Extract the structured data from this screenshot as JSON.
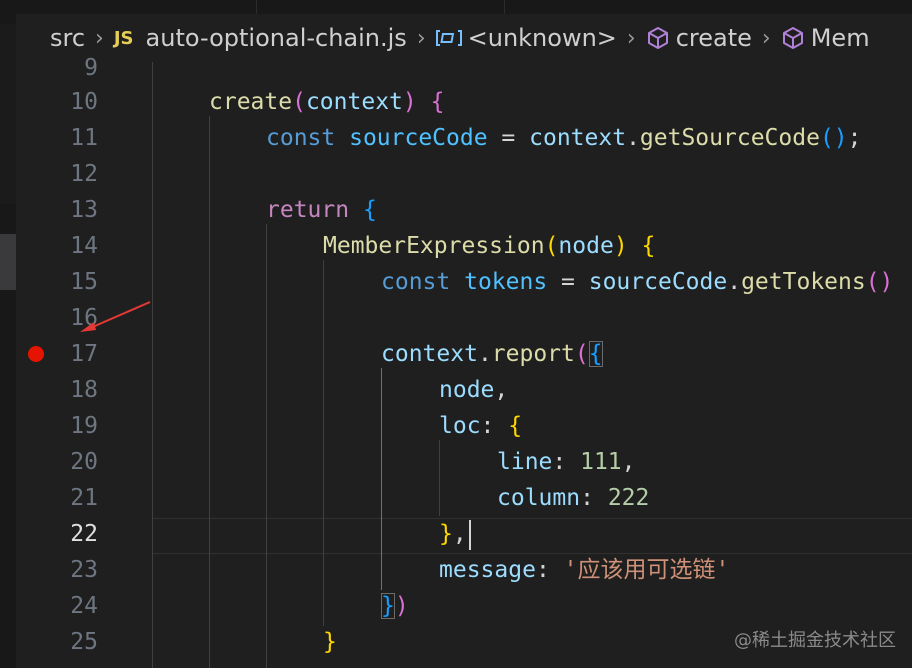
{
  "breadcrumb": {
    "folder": "src",
    "file_badge": "JS",
    "file": "auto-optional-chain.js",
    "scope1": "<unknown>",
    "scope2": "create",
    "scope3": "Mem"
  },
  "editor": {
    "active_line": "22",
    "breakpoint_line": "17",
    "lines": [
      {
        "n": "9"
      },
      {
        "n": "10",
        "t": {
          "a": "create",
          "b": "(",
          "c": "context",
          "d": ")",
          "e": " ",
          "f": "{"
        }
      },
      {
        "n": "11",
        "t": {
          "a": "const",
          "b": " sourceCode ",
          "c": "=",
          "d": " context",
          "e": ".",
          "f": "getSourceCode",
          "g": "(",
          "h": ")",
          "i": ";"
        }
      },
      {
        "n": "12"
      },
      {
        "n": "13",
        "t": {
          "a": "return",
          "b": " ",
          "c": "{"
        }
      },
      {
        "n": "14",
        "t": {
          "a": "MemberExpression",
          "b": "(",
          "c": "node",
          "d": ")",
          "e": " ",
          "f": "{"
        }
      },
      {
        "n": "15",
        "t": {
          "a": "const",
          "b": " tokens ",
          "c": "=",
          "d": " sourceCode",
          "e": ".",
          "f": "getTokens",
          "g": "()"
        }
      },
      {
        "n": "16"
      },
      {
        "n": "17",
        "t": {
          "a": "context",
          "b": ".",
          "c": "report",
          "d": "(",
          "e": "{"
        }
      },
      {
        "n": "18",
        "t": {
          "a": "node",
          "b": ","
        }
      },
      {
        "n": "19",
        "t": {
          "a": "loc",
          "b": ":",
          "c": " ",
          "d": "{"
        }
      },
      {
        "n": "20",
        "t": {
          "a": "line",
          "b": ":",
          "c": " ",
          "d": "111",
          "e": ","
        }
      },
      {
        "n": "21",
        "t": {
          "a": "column",
          "b": ":",
          "c": " ",
          "d": "222"
        }
      },
      {
        "n": "22",
        "t": {
          "a": "}",
          "b": ","
        }
      },
      {
        "n": "23",
        "t": {
          "a": "message",
          "b": ":",
          "c": " ",
          "d": "'应该用可选链'"
        }
      },
      {
        "n": "24",
        "t": {
          "a": "}",
          "b": ")"
        }
      },
      {
        "n": "25",
        "t": {
          "a": "}"
        }
      }
    ]
  },
  "watermark": "@稀土掘金技术社区",
  "colors": {
    "background": "#1f1f1f",
    "breakpoint": "#e51400",
    "arrow": "#e53935",
    "js_badge": "#e6cd55",
    "symbol_icon": "#b180d7"
  },
  "icons": {
    "breadcrumb_separator": "chevron-right-icon",
    "scope1": "variable-icon",
    "scope2": "method-cube-icon",
    "scope3": "method-cube-icon",
    "annotation": "red-arrow-icon"
  }
}
